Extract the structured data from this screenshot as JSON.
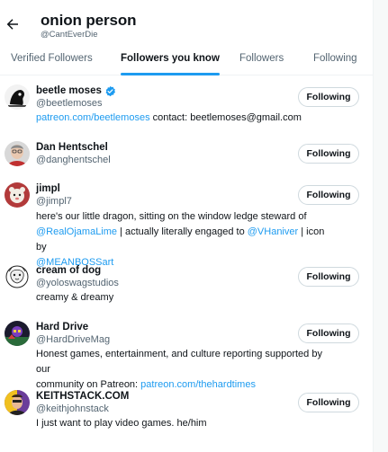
{
  "header": {
    "title": "onion person",
    "handle": "@CantEverDie"
  },
  "tabs": [
    {
      "label": "Verified Followers",
      "active": false
    },
    {
      "label": "Followers you know",
      "active": true
    },
    {
      "label": "Followers",
      "active": false
    },
    {
      "label": "Following",
      "active": false
    }
  ],
  "users": [
    {
      "name": "beetle moses",
      "verified": true,
      "handle": "@beetlemoses",
      "button": "Following",
      "bio_lines": [
        [
          {
            "t": "patreon.com/beetlemoses",
            "link": true
          },
          {
            "t": " contact: beetlemoses@gmail.com",
            "link": false
          }
        ]
      ]
    },
    {
      "name": "Dan Hentschel",
      "verified": false,
      "handle": "@danghentschel",
      "button": "Following",
      "bio_lines": []
    },
    {
      "name": "jimpl",
      "verified": false,
      "handle": "@jimpl7",
      "button": "Following",
      "bio_lines": [
        [
          {
            "t": "here's our little dragon, sitting on the window ledge steward of",
            "link": false
          }
        ],
        [
          {
            "t": "@RealOjamaLime",
            "link": true
          },
          {
            "t": " | actually literally engaged to ",
            "link": false
          },
          {
            "t": "@VHaniver",
            "link": true
          },
          {
            "t": " | icon by",
            "link": false
          }
        ],
        [
          {
            "t": "@MEANBOSSart",
            "link": true
          }
        ]
      ]
    },
    {
      "name": "cream of dog",
      "verified": false,
      "handle": "@yoloswagstudios",
      "button": "Following",
      "bio_lines": [
        [
          {
            "t": "creamy & dreamy",
            "link": false
          }
        ]
      ]
    },
    {
      "name": "Hard Drive",
      "verified": false,
      "handle": "@HardDriveMag",
      "button": "Following",
      "bio_lines": [
        [
          {
            "t": "Honest games, entertainment, and culture reporting supported by our",
            "link": false
          }
        ],
        [
          {
            "t": "community on Patreon: ",
            "link": false
          },
          {
            "t": "patreon.com/thehardtimes",
            "link": true
          }
        ]
      ]
    },
    {
      "name": "KEITHSTACK.COM",
      "verified": false,
      "handle": "@keithjohnstack",
      "button": "Following",
      "bio_lines": [
        [
          {
            "t": "I just want to play video games. he/him",
            "link": false
          }
        ]
      ]
    }
  ],
  "colors": {
    "accent": "#1d9bf0",
    "text": "#0f1419",
    "muted": "#536471",
    "border": "#cfd9de"
  },
  "icons": {
    "back": "arrow-left-icon",
    "verified": "verified-badge-icon"
  }
}
